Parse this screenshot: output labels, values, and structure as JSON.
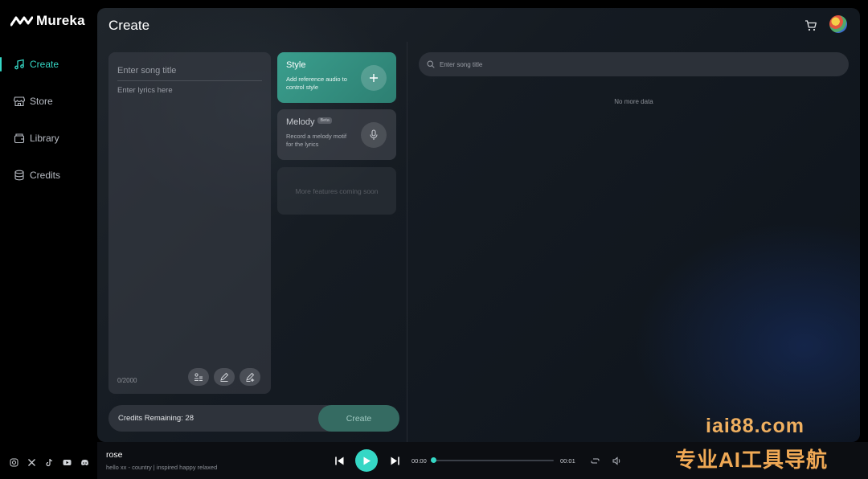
{
  "app": {
    "name": "Mureka"
  },
  "sidebar": {
    "items": [
      {
        "label": "Create",
        "icon": "music-note-icon",
        "active": true
      },
      {
        "label": "Store",
        "icon": "store-icon",
        "active": false
      },
      {
        "label": "Library",
        "icon": "library-icon",
        "active": false
      },
      {
        "label": "Credits",
        "icon": "database-icon",
        "active": false
      }
    ],
    "socials": [
      "instagram-icon",
      "x-icon",
      "tiktok-icon",
      "youtube-icon",
      "discord-icon"
    ]
  },
  "header": {
    "title": "Create"
  },
  "editor": {
    "title_placeholder": "Enter song title",
    "lyrics_placeholder": "Enter lyrics here",
    "char_count": "0/2000"
  },
  "style_card": {
    "title": "Style",
    "description": "Add reference audio to control style"
  },
  "melody_card": {
    "title": "Melody",
    "badge": "Beta",
    "description": "Record a melody motif for the lyrics"
  },
  "more_card": {
    "text": "More features coming soon"
  },
  "credits_bar": {
    "text": "Credits Remaining: 28",
    "create_label": "Create"
  },
  "library_panel": {
    "search_placeholder": "Enter song title",
    "empty_text": "No more data"
  },
  "player": {
    "title": "rose",
    "meta": "hello xx - country | inspired happy relaxed",
    "time_current": "00:00",
    "time_total": "00:01",
    "progress": 0
  },
  "watermark": {
    "url": "iai88.com",
    "text": "专业AI工具导航"
  },
  "colors": {
    "accent": "#35d7c5",
    "style_card": "#3a9e8d",
    "background": "#000000"
  }
}
